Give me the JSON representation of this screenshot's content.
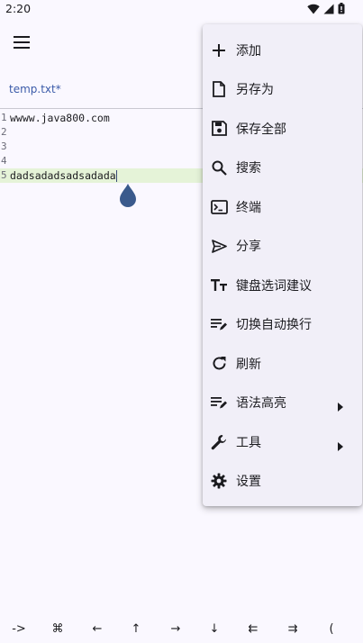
{
  "status_bar": {
    "time": "2:20",
    "icons": [
      "wifi-icon",
      "signal-icon",
      "battery-icon"
    ]
  },
  "toolbar": {
    "menu_icon": "hamburger-menu-icon"
  },
  "tabs": [
    {
      "label": "temp.txt*"
    }
  ],
  "editor": {
    "lines": [
      {
        "number": "1",
        "text": "wwww.java800.com"
      },
      {
        "number": "2",
        "text": ""
      },
      {
        "number": "3",
        "text": ""
      },
      {
        "number": "4",
        "text": ""
      },
      {
        "number": "5",
        "text": "dadsadadsadsadada"
      }
    ],
    "current_line": "5"
  },
  "overflow_menu": {
    "items": [
      {
        "label": "添加",
        "icon": "plus-icon"
      },
      {
        "label": "另存为",
        "icon": "file-icon"
      },
      {
        "label": "保存全部",
        "icon": "save-icon"
      },
      {
        "label": "搜索",
        "icon": "search-icon"
      },
      {
        "label": "终端",
        "icon": "terminal-icon"
      },
      {
        "label": "分享",
        "icon": "send-icon"
      },
      {
        "label": "键盘选词建议",
        "icon": "text-size-icon"
      },
      {
        "label": "切换自动换行",
        "icon": "wrap-text-icon"
      },
      {
        "label": "刷新",
        "icon": "refresh-icon"
      },
      {
        "label": "语法高亮",
        "icon": "edit-list-icon",
        "submenu": true
      },
      {
        "label": "工具",
        "icon": "wrench-icon",
        "submenu": true
      },
      {
        "label": "设置",
        "icon": "gear-icon"
      }
    ]
  },
  "symbol_bar": {
    "keys": [
      "->",
      "⌘",
      "←",
      "↑",
      "→",
      "↓",
      "⇇",
      "⇉",
      "("
    ]
  }
}
